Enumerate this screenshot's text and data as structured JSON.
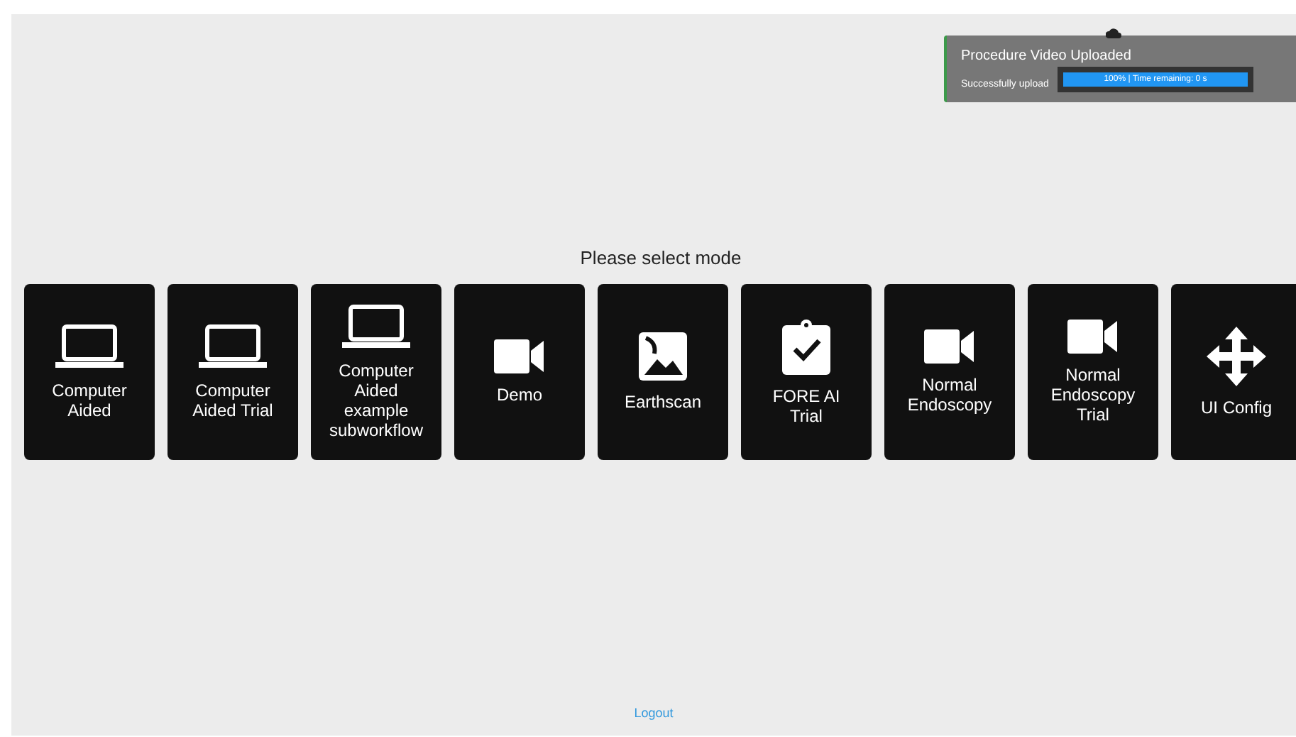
{
  "notification": {
    "title": "Procedure Video Uploaded",
    "message": "Successfully upload",
    "progress": {
      "text": "100% | Time remaining: 0 s",
      "level": 1
    }
  },
  "heading": "Please select mode",
  "modes": [
    {
      "label": "Computer Aided",
      "kind": "laptop"
    },
    {
      "label": "Computer Aided Trial",
      "kind": "laptop"
    },
    {
      "label": "Computer Aided example subworkflow",
      "kind": "laptop"
    },
    {
      "label": "Demo",
      "kind": "video"
    },
    {
      "label": "Earthscan",
      "kind": "image"
    },
    {
      "label": "FORE AI Trial",
      "kind": "clipboard"
    },
    {
      "label": "Normal Endoscopy",
      "kind": "video"
    },
    {
      "label": "Normal Endoscopy Trial",
      "kind": "video"
    },
    {
      "label": "UI Config",
      "kind": "move"
    }
  ],
  "logout": "Logout"
}
